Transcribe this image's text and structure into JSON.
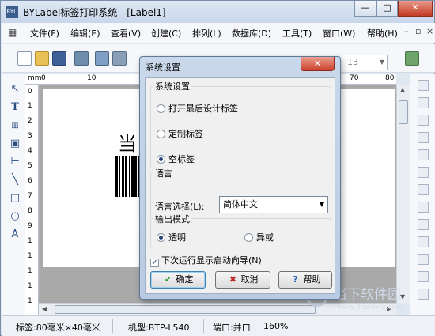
{
  "window": {
    "title": "BYLabel标签打印系统 - [Label1]",
    "app_icon_text": "BYL",
    "controls": {
      "minimize": "—",
      "maximize": "□",
      "close": "✕"
    }
  },
  "menubar": {
    "items": [
      "文件(F)",
      "编辑(E)",
      "查看(V)",
      "创建(C)",
      "排列(L)",
      "数据库(D)",
      "工具(T)",
      "窗口(W)",
      "帮助(H)"
    ],
    "mdi_controls": [
      "–",
      "▫",
      "×"
    ]
  },
  "toolbar": {
    "font_size_value": "13"
  },
  "ruler": {
    "unit": "mm",
    "h_ticks": [
      "0",
      "10",
      "70",
      "80"
    ],
    "v_ticks": [
      "0",
      "1",
      "2",
      "3",
      "4",
      "5",
      "6",
      "7",
      "8",
      "9",
      "1",
      "1",
      "1",
      "1",
      "1"
    ]
  },
  "canvas": {
    "big_char": "当"
  },
  "statusbar": {
    "label_size": "标签:80毫米×40毫米",
    "model": "机型:BTP-L540",
    "port": "端口:并口",
    "zoom": "160%"
  },
  "watermark": {
    "title": "当下软件园",
    "url": "www.downxia.com"
  },
  "dialog": {
    "title": "系统设置",
    "close": "✕",
    "section_system": "系统设置",
    "options": [
      {
        "label": "打开最后设计标签",
        "selected": false
      },
      {
        "label": "定制标签",
        "selected": false
      },
      {
        "label": "空标签",
        "selected": true
      }
    ],
    "section_language": "语言",
    "language_label": "语言选择(L):",
    "language_value": "简体中文",
    "section_output": "输出模式",
    "output_options": [
      {
        "label": "透明",
        "selected": true
      },
      {
        "label": "异或",
        "selected": false
      }
    ],
    "wizard_check_label": "下次运行显示启动向导(N)",
    "wizard_checked": true,
    "buttons": {
      "ok": "确定",
      "cancel": "取消",
      "help": "帮助"
    }
  },
  "colors": {
    "accent": "#26467a",
    "close_red": "#c9412b",
    "ok_icon": "#2a9d3a",
    "cancel_icon": "#c0282b",
    "help_icon": "#2a64b8"
  }
}
